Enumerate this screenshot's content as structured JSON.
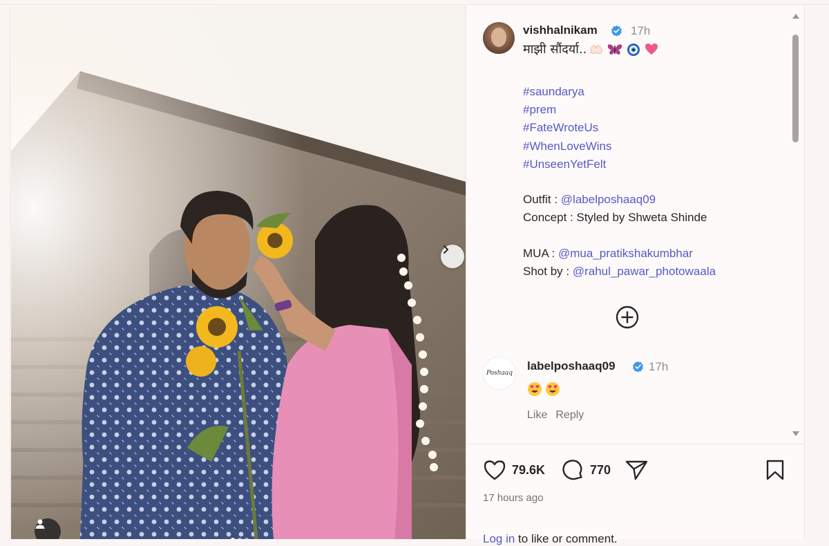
{
  "post": {
    "author": "vishhalnikam",
    "time": "17h",
    "caption_text": "माझी सौंदर्या..",
    "caption_emojis": [
      "folded-hands-emoji",
      "butterfly-emoji",
      "evil-eye-emoji",
      "pink-heart-emoji"
    ],
    "hashtags": [
      "#saundarya",
      "#prem",
      "#FateWroteUs",
      "#WhenLoveWins",
      "#UnseenYetFelt"
    ],
    "credits": {
      "outfit_label": "Outfit : ",
      "outfit_handle": "@labelposhaaq09",
      "concept": "Concept : Styled by Shweta Shinde",
      "mua_label": "MUA : ",
      "mua_handle": "@mua_pratikshakumbhar",
      "shot_label": "Shot by : ",
      "shot_handle": "@rahul_pawar_photowaala"
    }
  },
  "comment": {
    "author": "labelposhaaq09",
    "avatar_text": "Poshaaq",
    "time": "17h",
    "emojis": [
      "heart-eyes-emoji",
      "heart-eyes-emoji"
    ],
    "like_label": "Like",
    "reply_label": "Reply"
  },
  "stats": {
    "likes": "79.6K",
    "comments": "770"
  },
  "posted_ago": "17 hours ago",
  "login": {
    "link": "Log in",
    "rest": " to like or comment."
  },
  "icons": {
    "verified": "verified-badge-icon",
    "next": "chevron-right-icon",
    "tag": "user-tag-icon",
    "more": "plus-circle-icon",
    "like": "heart-icon",
    "comment": "comment-bubble-icon",
    "share": "send-icon",
    "save": "bookmark-icon"
  },
  "colors": {
    "link": "#5659c9",
    "verified": "#3897f0",
    "muted": "#737373"
  }
}
